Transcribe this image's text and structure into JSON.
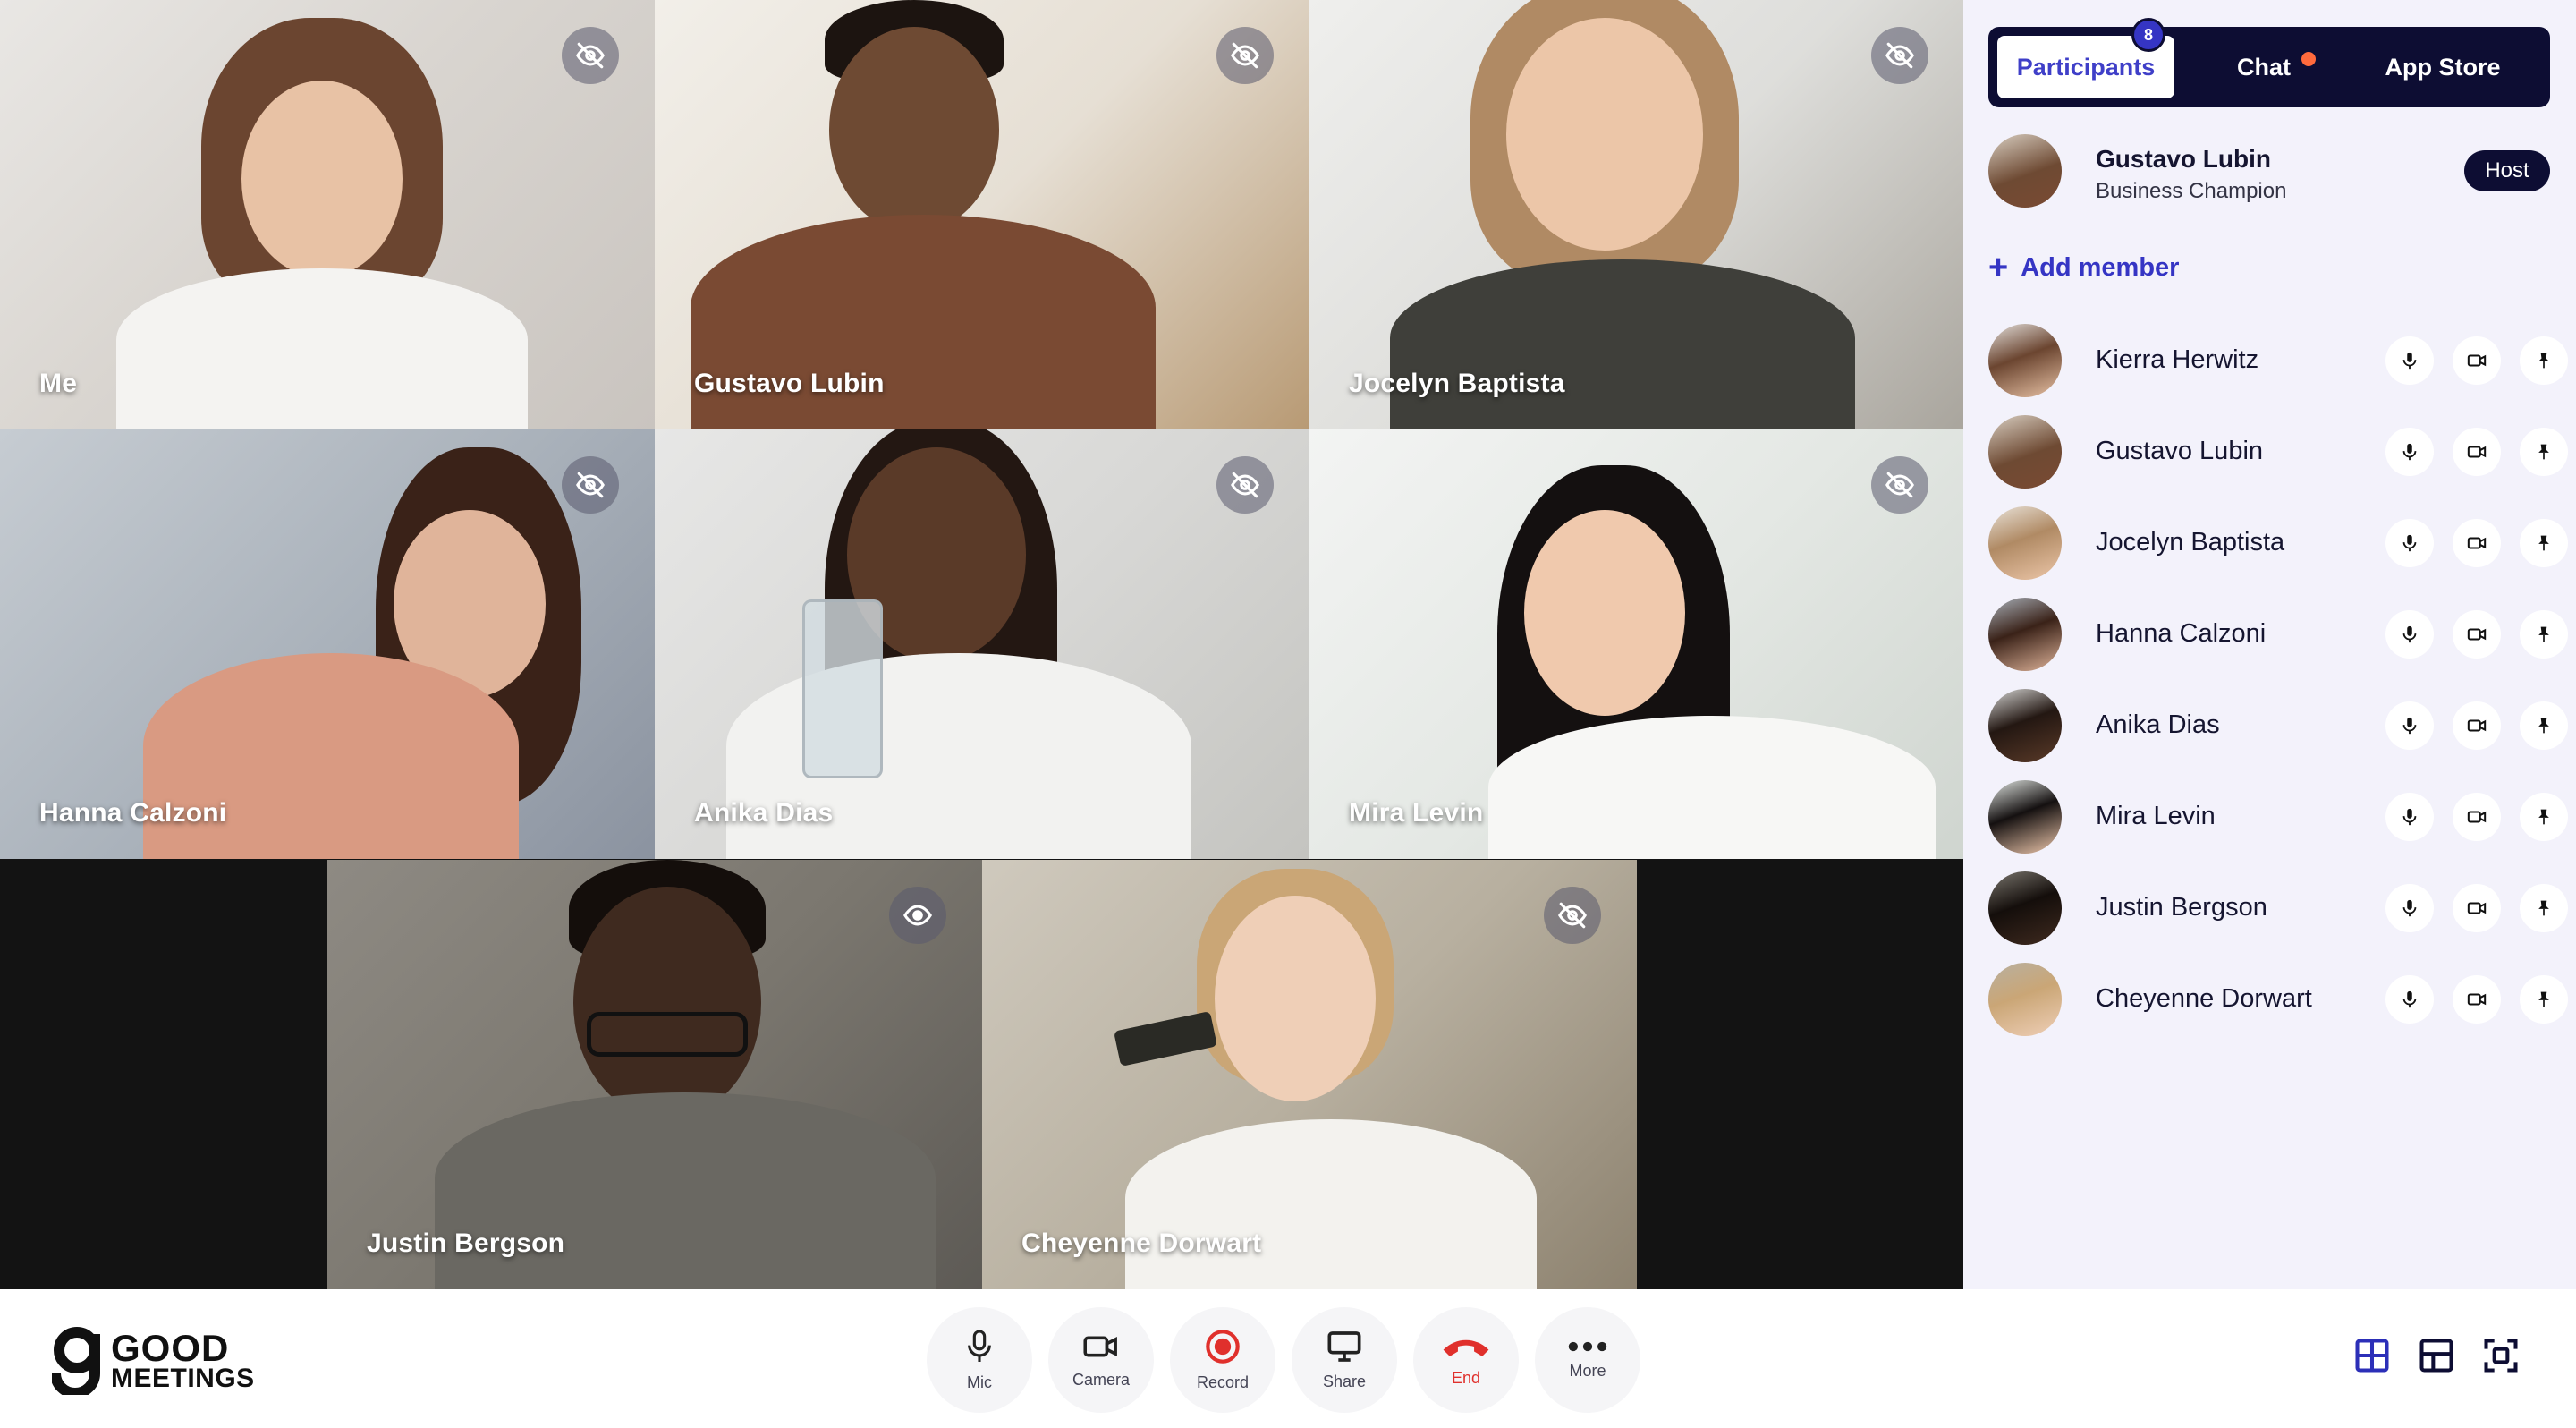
{
  "tiles": [
    {
      "name": "Me",
      "icon": "eye-off-icon"
    },
    {
      "name": "Gustavo Lubin",
      "icon": "eye-off-icon"
    },
    {
      "name": "Jocelyn Baptista",
      "icon": "eye-off-icon"
    },
    {
      "name": "Hanna Calzoni",
      "icon": "eye-off-icon"
    },
    {
      "name": "Anika Dias",
      "icon": "eye-off-icon"
    },
    {
      "name": "Mira Levin",
      "icon": "eye-off-icon"
    },
    {
      "name": "Justin Bergson",
      "icon": "eye-icon"
    },
    {
      "name": "Cheyenne Dorwart",
      "icon": "eye-off-icon"
    }
  ],
  "panel": {
    "tabs": {
      "participants": "Participants",
      "participants_count": "8",
      "chat": "Chat",
      "app_store": "App Store"
    },
    "host": {
      "name": "Gustavo Lubin",
      "title": "Business Champion",
      "badge": "Host"
    },
    "add_member": "Add member",
    "participants": [
      {
        "name": "Kierra Herwitz"
      },
      {
        "name": "Gustavo Lubin"
      },
      {
        "name": "Jocelyn Baptista"
      },
      {
        "name": "Hanna Calzoni"
      },
      {
        "name": "Anika Dias"
      },
      {
        "name": "Mira Levin"
      },
      {
        "name": "Justin Bergson"
      },
      {
        "name": "Cheyenne Dorwart"
      }
    ]
  },
  "toolbar": {
    "logo_line1": "GOOD",
    "logo_line2": "MEETINGS",
    "mic": "Mic",
    "camera": "Camera",
    "record": "Record",
    "share": "Share",
    "end": "End",
    "more": "More"
  },
  "colors": {
    "accent": "#3535c4",
    "dark": "#0d0d33",
    "end": "#e0302c",
    "record": "#e0302c",
    "chat_dot": "#ff6a3d"
  }
}
